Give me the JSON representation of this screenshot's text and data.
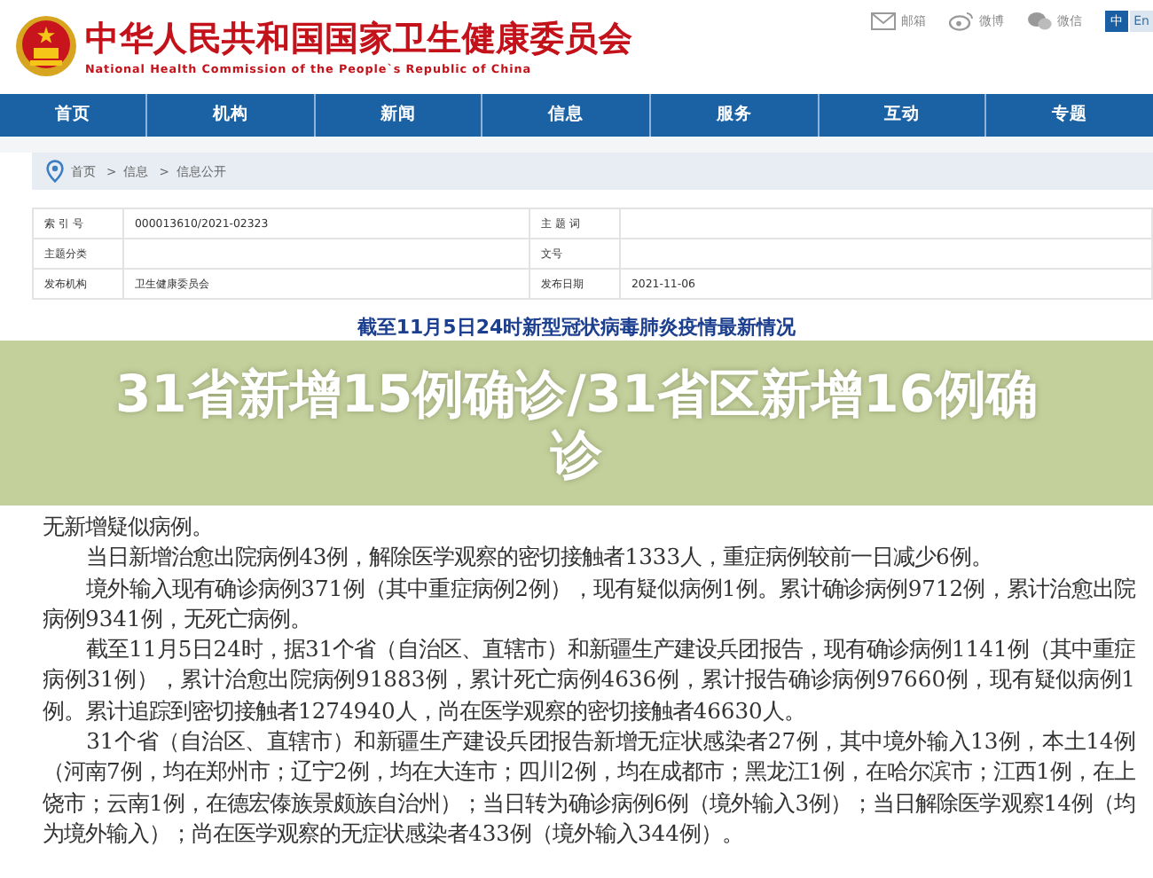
{
  "header": {
    "site_title": "中华人民共和国国家卫生健康委员会",
    "site_subtitle": "National Health Commission of the People`s Republic of China",
    "links": [
      {
        "kind": "mail",
        "label": "邮箱"
      },
      {
        "kind": "weibo",
        "label": "微博"
      },
      {
        "kind": "wechat",
        "label": "微信"
      }
    ],
    "languages": [
      {
        "label": "中",
        "selected": true
      },
      {
        "label": "En",
        "selected": false
      }
    ]
  },
  "nav": [
    "首页",
    "机构",
    "新闻",
    "信息",
    "服务",
    "互动",
    "专题"
  ],
  "breadcrumb": {
    "separator": ">",
    "items": [
      "首页",
      "信息",
      "信息公开"
    ]
  },
  "info_table": [
    {
      "label_1": "索 引 号",
      "value_1": "000013610/2021-02323",
      "label_2": "主 题 词"
    },
    {
      "label_1": "主题分类",
      "label_2": "文号"
    },
    {
      "label_1": "发布机构",
      "value_1": "卫生健康委员会",
      "label_2": "发布日期",
      "value_2": "2021-11-06"
    }
  ],
  "article": {
    "heading": "截至11月5日24时新型冠状病毒肺炎疫情最新情况",
    "paragraphs": [
      {
        "kind": "continued",
        "text": "无新增疑似病例。"
      },
      {
        "kind": "new",
        "text": "当日新增治愈出院病例43例，解除医学观察的密切接触者1333人，重症病例较前一日减少6例。"
      },
      {
        "kind": "new",
        "text": "境外输入现有确诊病例371例（其中重症病例2例），现有疑似病例1例。累计确诊病例9712例，累计治愈出院病例9341例，无死亡病例。"
      },
      {
        "kind": "new",
        "text": "截至11月5日24时，据31个省（自治区、直辖市）和新疆生产建设兵团报告，现有确诊病例1141例（其中重症病例31例），累计治愈出院病例91883例，累计死亡病例4636例，累计报告确诊病例97660例，现有疑似病例1例。累计追踪到密切接触者1274940人，尚在医学观察的密切接触者46630人。"
      },
      {
        "kind": "new",
        "text": "31个省（自治区、直辖市）和新疆生产建设兵团报告新增无症状感染者27例，其中境外输入13例，本土14例（河南7例，均在郑州市；辽宁2例，均在大连市；四川2例，均在成都市；黑龙江1例，在哈尔滨市；江西1例，在上饶市；云南1例，在德宏傣族景颇族自治州）；当日转为确诊病例6例（境外输入3例）；当日解除医学观察14例（均为境外输入）；尚在医学观察的无症状感染者433例（境外输入344例）。"
      }
    ]
  },
  "overlay_title": "31省新增15例确诊/31省区新增16例确诊"
}
